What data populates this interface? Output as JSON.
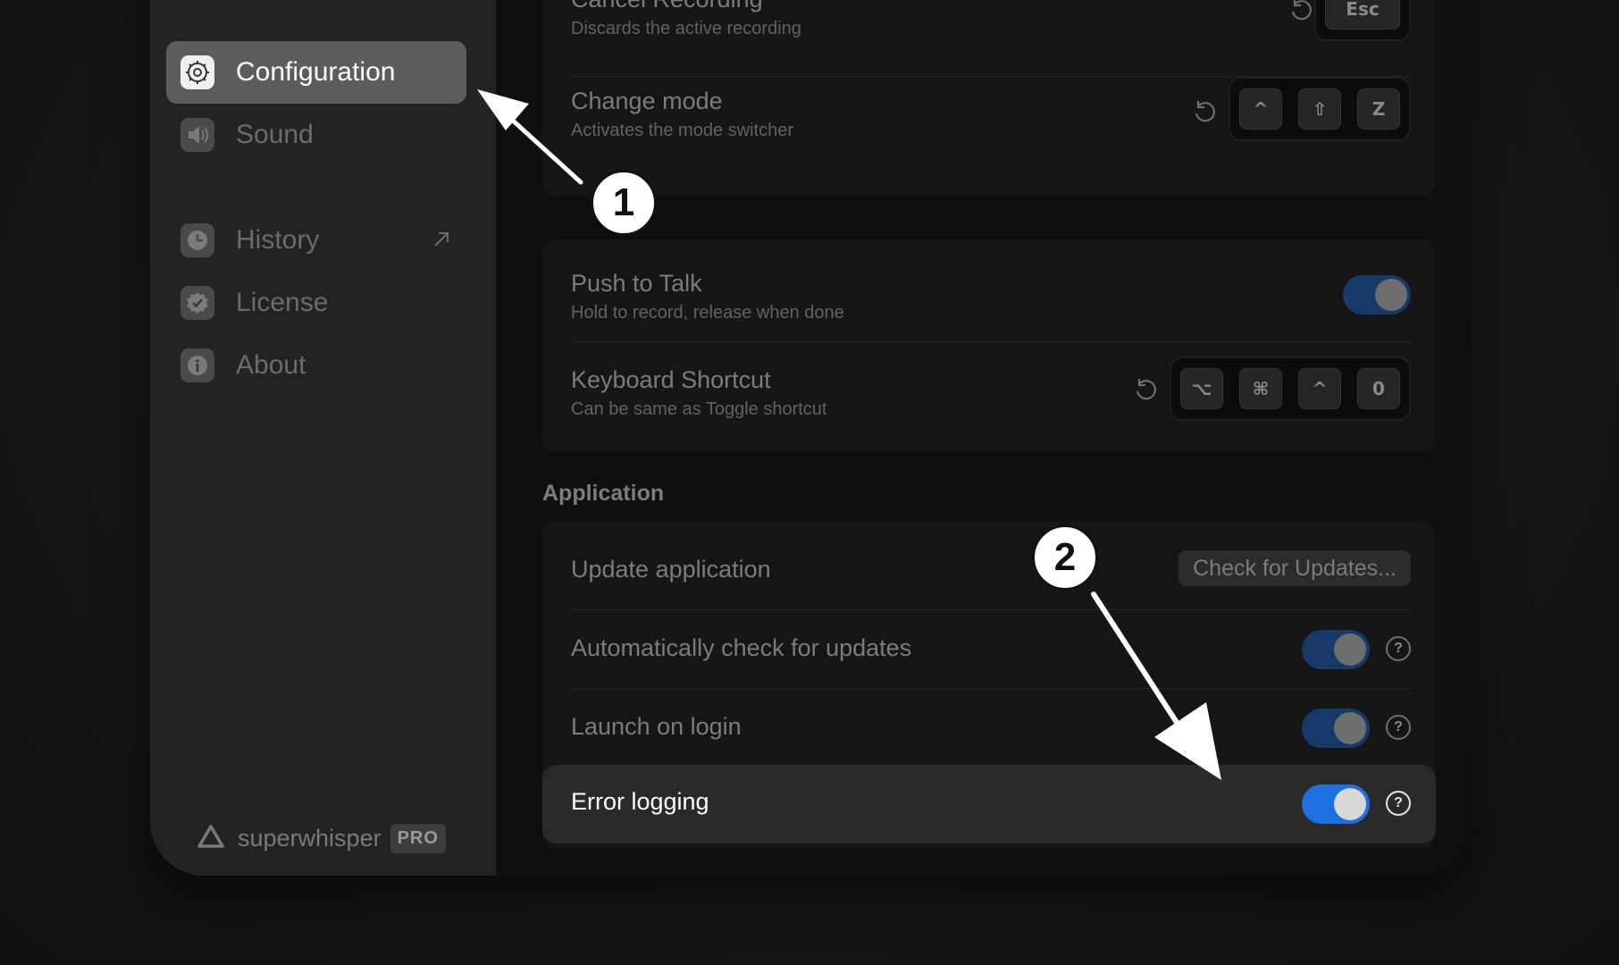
{
  "sidebar": {
    "items": [
      {
        "label": "Configuration",
        "icon": "gear-icon",
        "active": true
      },
      {
        "label": "Sound",
        "icon": "speaker-icon",
        "active": false
      },
      {
        "label": "History",
        "icon": "clock-icon",
        "active": false,
        "external": true
      },
      {
        "label": "License",
        "icon": "verified-badge-icon",
        "active": false
      },
      {
        "label": "About",
        "icon": "info-icon",
        "active": false
      }
    ],
    "brand": {
      "name": "superwhisper",
      "badge": "PRO"
    }
  },
  "shortcuts_card": {
    "cancel_recording": {
      "title": "Cancel Recording",
      "subtitle": "Discards the active recording",
      "keys": [
        "Esc"
      ]
    },
    "change_mode": {
      "title": "Change mode",
      "subtitle": "Activates the mode switcher",
      "keys": [
        "^",
        "⇧",
        "Z"
      ]
    }
  },
  "push_card": {
    "push_to_talk": {
      "title": "Push to Talk",
      "subtitle": "Hold to record, release when done",
      "enabled": true
    },
    "keyboard_shortcut": {
      "title": "Keyboard Shortcut",
      "subtitle": "Can be same as Toggle shortcut",
      "keys": [
        "⌥",
        "⌘",
        "^",
        "0"
      ]
    }
  },
  "application": {
    "section_label": "Application",
    "update": {
      "title": "Update application",
      "button": "Check for Updates..."
    },
    "auto_check": {
      "title": "Automatically check for updates",
      "enabled": true
    },
    "launch_on_login": {
      "title": "Launch on login",
      "enabled": true
    },
    "error_logging": {
      "title": "Error logging",
      "enabled": true
    }
  },
  "annotations": {
    "step1": "1",
    "step2": "2"
  },
  "colors": {
    "accent": "#1f6fe0",
    "toggle_dim": "#183a6b",
    "annotation": "#ffffff"
  }
}
